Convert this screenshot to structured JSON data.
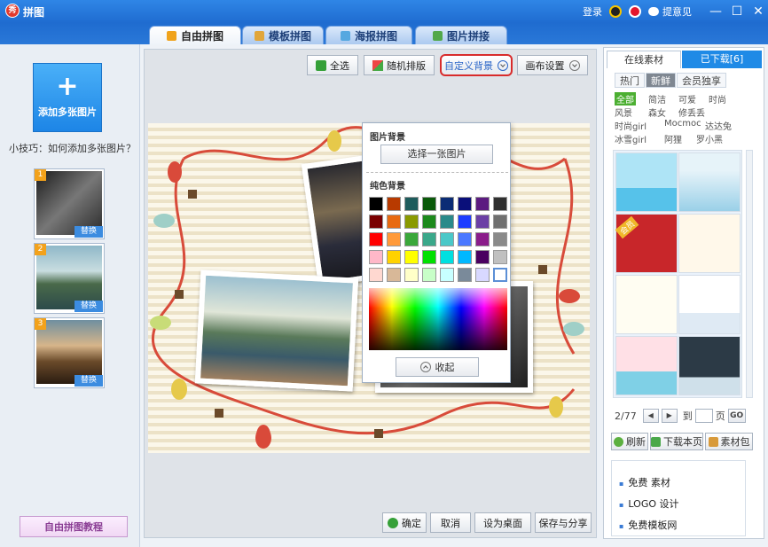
{
  "window": {
    "title": "拼图",
    "logo": "秀",
    "login": "登录",
    "feedback": "提意见",
    "minimize": "—",
    "maximize": "☐",
    "close": "✕"
  },
  "tabs": [
    {
      "label": "自由拼图",
      "active": true,
      "icon_color": "#f0a31c"
    },
    {
      "label": "模板拼图",
      "active": false,
      "icon_color": "#e1a63a"
    },
    {
      "label": "海报拼图",
      "active": false,
      "icon_color": "#56a8e0"
    },
    {
      "label": "图片拼接",
      "active": false,
      "icon_color": "#52a84a"
    }
  ],
  "left": {
    "add_button": "添加多张图片",
    "plus": "+",
    "tip": "小技巧：如何添加多张图片？",
    "thumbnails": [
      {
        "num": "1",
        "replace": "替换"
      },
      {
        "num": "2",
        "replace": "替换"
      },
      {
        "num": "3",
        "replace": "替换"
      }
    ],
    "tutorial": "自由拼图教程"
  },
  "toolbar": {
    "select_all": "全选",
    "random_layout": "随机排版",
    "custom_bg": "自定义背景",
    "canvas_settings": "画布设置"
  },
  "dropdown": {
    "image_bg_title": "图片背景",
    "choose_image": "选择一张图片",
    "solid_bg_title": "纯色背景",
    "collapse": "收起",
    "swatches": [
      "#000000",
      "#b83a00",
      "#1e5c5c",
      "#0a5a0a",
      "#0b2c75",
      "#0a0f7a",
      "#5c1b80",
      "#303030",
      "#7a0000",
      "#e86a10",
      "#8a9a00",
      "#1c8a1c",
      "#2a8a8a",
      "#1c3cff",
      "#6b3fa5",
      "#707070",
      "#ff0000",
      "#ff9a3a",
      "#3aa83a",
      "#3aa88a",
      "#4ac8c8",
      "#4a78ff",
      "#8a1c8a",
      "#8a8a8a",
      "#ffb8c8",
      "#ffd200",
      "#ffff00",
      "#00e000",
      "#00e0e0",
      "#00b8ff",
      "#4a0060",
      "#c0c0c0",
      "#ffd8d0",
      "#d8b898",
      "#ffffc8",
      "#c8ffc8",
      "#c8ffff",
      "#7a8a9a",
      "#d8d8ff",
      "#ffffff"
    ]
  },
  "bottom": {
    "ok": "确定",
    "cancel": "取消",
    "set_desktop": "设为桌面",
    "save_share": "保存与分享"
  },
  "right": {
    "tab_online": "在线素材",
    "tab_downloaded": "已下载[6]",
    "segments": [
      "热门",
      "新鲜",
      "会员独享"
    ],
    "categories": [
      [
        "全部",
        "简洁",
        "可爱",
        "时尚"
      ],
      [
        "风景",
        "森女",
        "修丢丢"
      ],
      [
        "时尚girl",
        "Mocmoc",
        "达达兔"
      ],
      [
        "冰雪girl",
        "阿狸",
        "罗小黑"
      ]
    ],
    "member_badge": "会员",
    "pager": {
      "page": "2/77",
      "prev": "◀",
      "next": "▶",
      "goto_label": "到",
      "page_label": "页",
      "go": "GO"
    },
    "refresh": "刷新",
    "download_page": "下载本页",
    "material_pack": "素材包",
    "links": [
      "免费 素材",
      "LOGO 设计",
      "免费模板网"
    ]
  }
}
